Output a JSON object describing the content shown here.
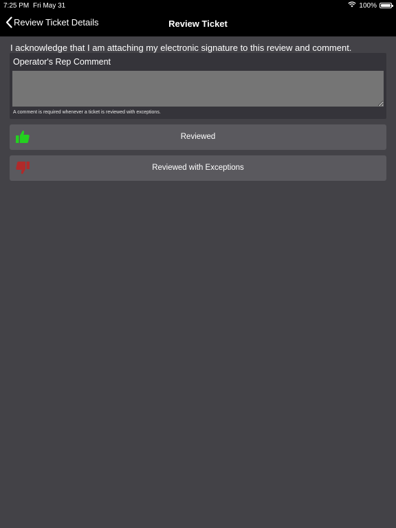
{
  "status_bar": {
    "time": "7:25 PM",
    "date": "Fri May 31",
    "battery": "100%",
    "wifi_icon": "wifi-icon",
    "battery_icon": "battery-icon"
  },
  "nav": {
    "back_label": "Review Ticket Details",
    "title": "Review Ticket"
  },
  "acknowledgement": "I acknowledge that I am attaching my electronic signature to this review and comment.",
  "comment": {
    "label": "Operator's Rep Comment",
    "value": "",
    "hint": "A comment is required whenever a ticket is reviewed with exceptions."
  },
  "actions": [
    {
      "label": "Reviewed",
      "icon": "thumbs-up-icon",
      "color": "#2ecc2e"
    },
    {
      "label": "Reviewed with Exceptions",
      "icon": "thumbs-down-icon",
      "color": "#b83232"
    }
  ]
}
